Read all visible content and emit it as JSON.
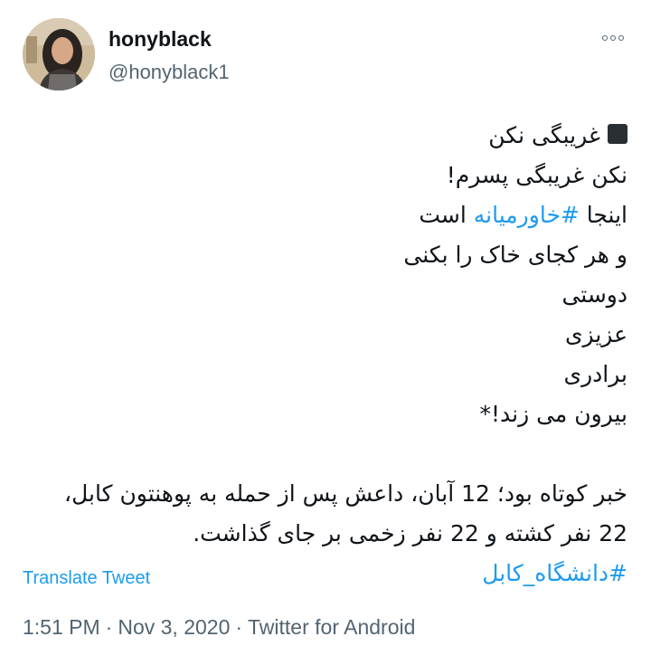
{
  "author": {
    "display_name": "honyblack",
    "handle": "@honyblack1",
    "more_icon": "more-horizontal-icon"
  },
  "tweet": {
    "line1_text": "غریبگی نکن",
    "line2": "نکن غریبگی پسرم!",
    "line3_prefix": "اینجا",
    "line3_hashtag": "#خاورمیانه",
    "line3_suffix": "است",
    "line4": "و هر کجای خاک را بکنی",
    "line5": "دوستی",
    "line6": "عزیزی",
    "line7": "برادری",
    "line8": "بیرون می زند!*",
    "line9": "خبر کوتاه بود؛ 12 آبان، داعش پس از حمله به پوهنتون کابل،",
    "line10": "22 نفر کشته و 22 نفر زخمی بر جای گذاشت.",
    "line11_hashtag": "#دانشگاه_کابل"
  },
  "translate_label": "Translate Tweet",
  "meta": {
    "time": "1:51 PM",
    "date": "Nov 3, 2020",
    "source": "Twitter for Android",
    "separator": "·"
  },
  "colors": {
    "link": "#1d9bf0",
    "secondary_text": "#536471",
    "primary_text": "#0f1419"
  }
}
